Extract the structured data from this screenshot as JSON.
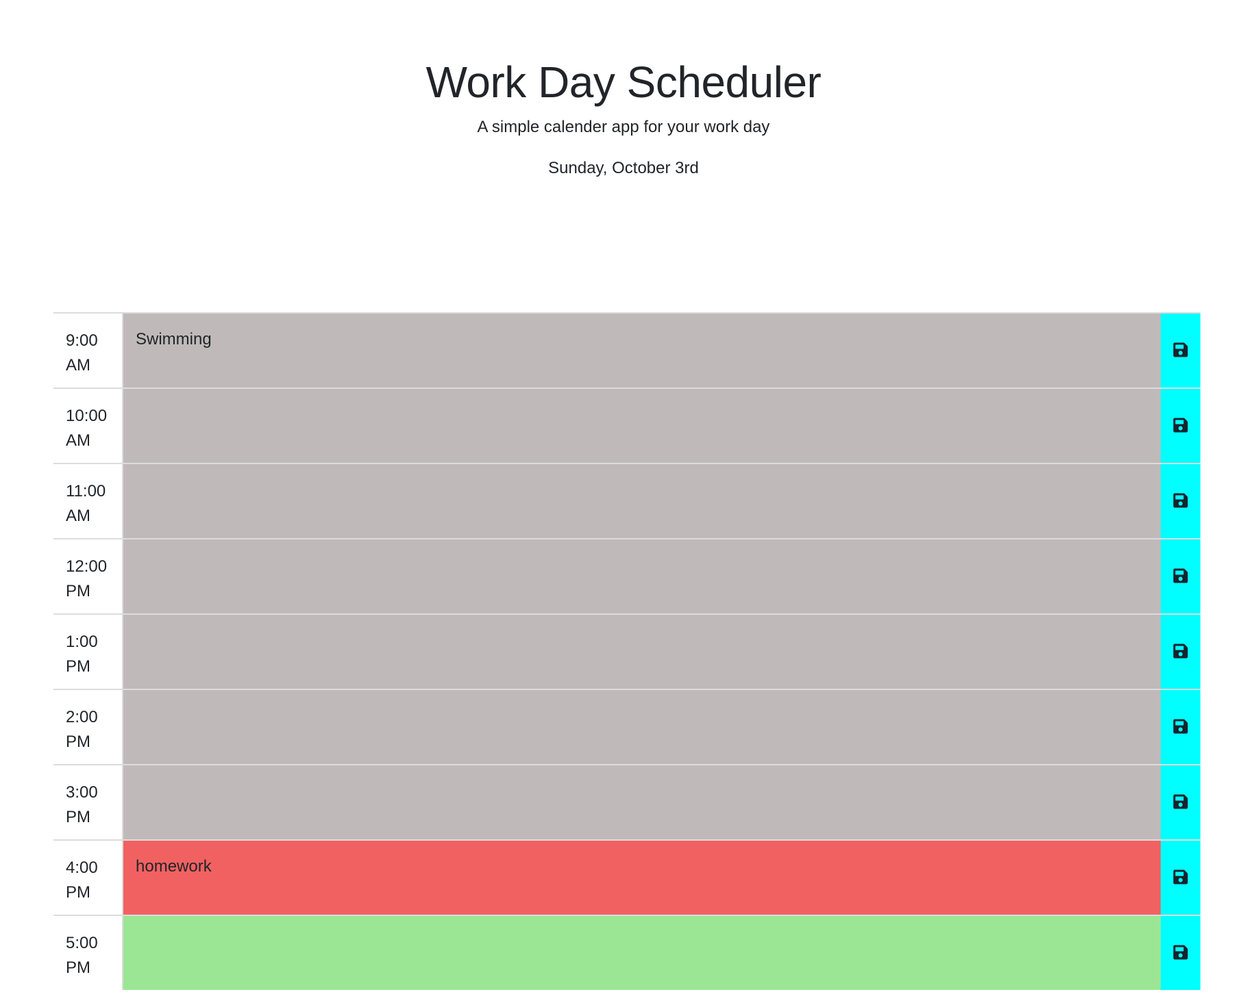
{
  "header": {
    "title": "Work Day Scheduler",
    "subtitle": "A simple calender app for your work day",
    "current_day": "Sunday, October 3rd"
  },
  "colors": {
    "past": "#bfbab9",
    "present": "#f26161",
    "future": "#9ae694",
    "save_button": "#00ffff"
  },
  "time_blocks": [
    {
      "hour": "9:00 AM",
      "text": "Swimming",
      "state": "past",
      "save_icon": "save-icon"
    },
    {
      "hour": "10:00 AM",
      "text": "",
      "state": "past",
      "save_icon": "save-icon"
    },
    {
      "hour": "11:00 AM",
      "text": "",
      "state": "past",
      "save_icon": "save-icon"
    },
    {
      "hour": "12:00 PM",
      "text": "",
      "state": "past",
      "save_icon": "save-icon"
    },
    {
      "hour": "1:00 PM",
      "text": "",
      "state": "past",
      "save_icon": "save-icon"
    },
    {
      "hour": "2:00 PM",
      "text": "",
      "state": "past",
      "save_icon": "save-icon"
    },
    {
      "hour": "3:00 PM",
      "text": "",
      "state": "past",
      "save_icon": "save-icon"
    },
    {
      "hour": "4:00 PM",
      "text": "homework",
      "state": "present",
      "save_icon": "save-icon"
    },
    {
      "hour": "5:00 PM",
      "text": "",
      "state": "future",
      "save_icon": "save-icon"
    }
  ]
}
